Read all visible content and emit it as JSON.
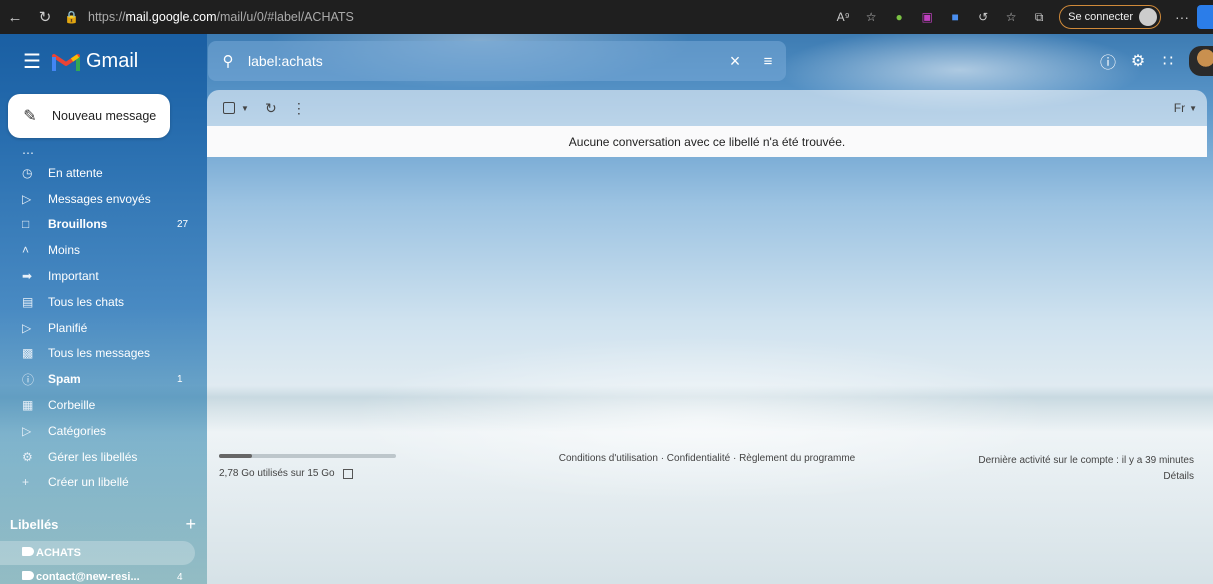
{
  "browser": {
    "url_prefix": "https://",
    "url_host": "mail.google.com",
    "url_path": "/mail/u/0/#label/ACHATS",
    "signin_label": "Se connecter",
    "more_label": "···"
  },
  "header": {
    "app_name": "Gmail",
    "search_query": "label:achats"
  },
  "sidebar": {
    "compose_label": "Nouveau message",
    "items": [
      {
        "label": "En attente",
        "count": "",
        "bold": false,
        "icon": "clock-icon"
      },
      {
        "label": "Messages envoyés",
        "count": "",
        "bold": false,
        "icon": "send-icon"
      },
      {
        "label": "Brouillons",
        "count": "27",
        "bold": true,
        "icon": "draft-icon"
      },
      {
        "label": "Moins",
        "count": "",
        "bold": false,
        "icon": "chevron-up-icon"
      },
      {
        "label": "Important",
        "count": "",
        "bold": false,
        "icon": "important-icon"
      },
      {
        "label": "Tous les chats",
        "count": "",
        "bold": false,
        "icon": "chat-icon"
      },
      {
        "label": "Planifié",
        "count": "",
        "bold": false,
        "icon": "scheduled-icon"
      },
      {
        "label": "Tous les messages",
        "count": "",
        "bold": false,
        "icon": "all-mail-icon"
      },
      {
        "label": "Spam",
        "count": "1",
        "bold": true,
        "icon": "spam-icon"
      },
      {
        "label": "Corbeille",
        "count": "",
        "bold": false,
        "icon": "trash-icon"
      },
      {
        "label": "Catégories",
        "count": "",
        "bold": false,
        "icon": "label-outline-icon"
      },
      {
        "label": "Gérer les libellés",
        "count": "",
        "bold": false,
        "icon": "gear-icon"
      },
      {
        "label": "Créer un libellé",
        "count": "",
        "bold": false,
        "icon": "plus-icon"
      }
    ],
    "labels_title": "Libellés",
    "labels": [
      {
        "label": "ACHATS",
        "count": ""
      },
      {
        "label": "contact@new-resi...",
        "count": "4"
      }
    ]
  },
  "main": {
    "empty_message": "Aucune conversation avec ce libellé n'a été trouvée.",
    "input_tool_label": "Fr",
    "storage_fraction": 0.185,
    "storage_text": "2,78 Go utilisés sur 15 Go",
    "footer_links": "Conditions d'utilisation · Confidentialité · Règlement du programme",
    "last_activity": "Dernière activité sur le compte : il y a 39 minutes",
    "details_label": "Détails"
  }
}
